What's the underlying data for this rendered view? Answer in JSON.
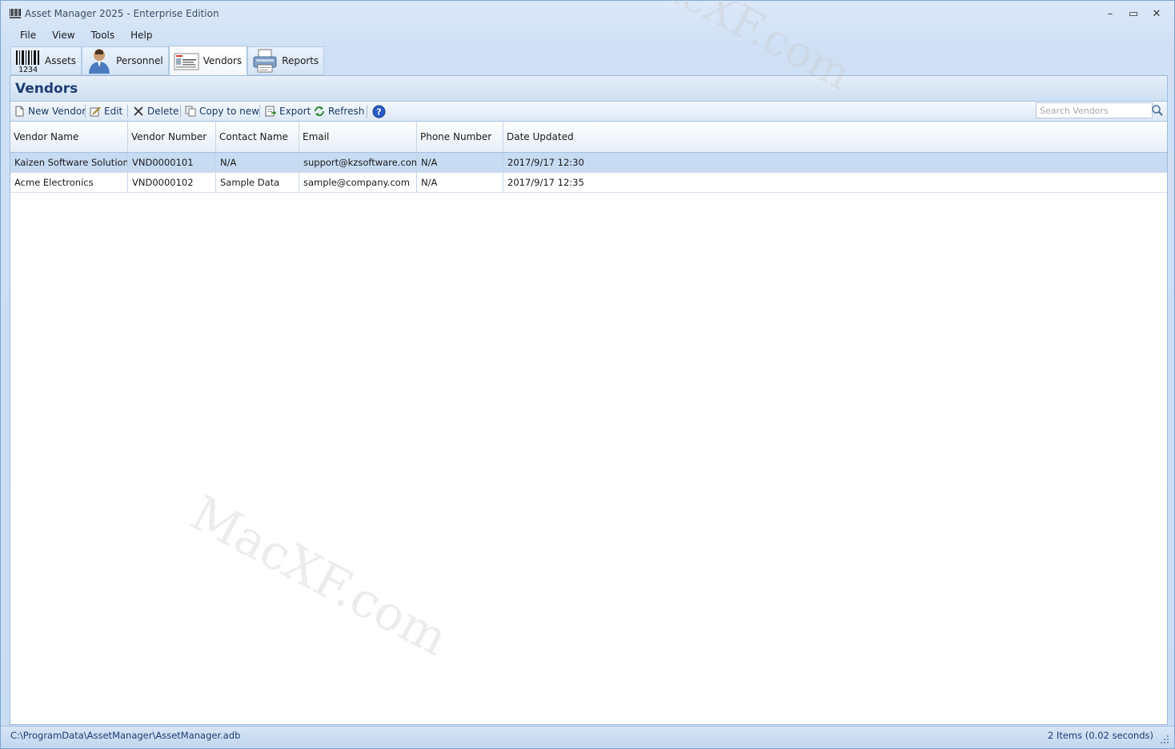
{
  "window": {
    "title": "Asset Manager 2025 - Enterprise Edition",
    "minimize_label": "–",
    "maximize_label": "▭",
    "close_label": "✕"
  },
  "menu": [
    "File",
    "View",
    "Tools",
    "Help"
  ],
  "tabs": [
    {
      "label": "Assets",
      "icon": "barcode-icon",
      "barcode_text": "1234"
    },
    {
      "label": "Personnel",
      "icon": "person-icon"
    },
    {
      "label": "Vendors",
      "icon": "vendor-card-icon"
    },
    {
      "label": "Reports",
      "icon": "printer-icon"
    }
  ],
  "panel": {
    "title": "Vendors"
  },
  "toolbar": {
    "new_label": "New Vendor",
    "edit_label": "Edit",
    "delete_label": "Delete",
    "copy_label": "Copy to new",
    "export_label": "Export",
    "refresh_label": "Refresh",
    "help_label": "?",
    "search_placeholder": "Search Vendors"
  },
  "grid": {
    "columns": [
      "Vendor Name",
      "Vendor Number",
      "Contact Name",
      "Email",
      "Phone Number",
      "Date Updated"
    ],
    "rows": [
      [
        "Kaizen Software Solutions",
        "VND0000101",
        "N/A",
        "support@kzsoftware.com",
        "N/A",
        "2017/9/17 12:30"
      ],
      [
        "Acme Electronics",
        "VND0000102",
        "Sample Data",
        "sample@company.com",
        "N/A",
        "2017/9/17 12:35"
      ]
    ],
    "selected_row": 0
  },
  "status": {
    "path": "C:\\ProgramData\\AssetManager\\AssetManager.adb",
    "count": "2 Items (0.02 seconds)"
  },
  "watermark": {
    "text": "MacXF.com"
  },
  "colors": {
    "accent": "#1f3d73",
    "selection": "#c7dbf2",
    "chrome": "#cfe0f5"
  }
}
